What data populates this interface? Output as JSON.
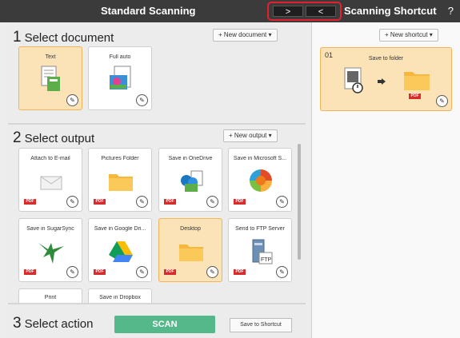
{
  "titlebar": {
    "left_title": "Standard Scanning",
    "right_title": "Scanning Shortcut",
    "help": "?",
    "nav_next": ">",
    "nav_prev": "<"
  },
  "document": {
    "number": "1",
    "heading": "Select document",
    "new_button": "+ New document ▾",
    "items": [
      {
        "label": "Text",
        "selected": true
      },
      {
        "label": "Full auto",
        "selected": false
      }
    ]
  },
  "output": {
    "number": "2",
    "heading": "Select output",
    "new_button": "+ New output ▾",
    "items": [
      {
        "label": "Attach to E-mail",
        "badge": "PDF",
        "icon": "envelope-icon"
      },
      {
        "label": "Pictures Folder",
        "badge": "PDF",
        "icon": "folder-icon"
      },
      {
        "label": "Save in OneDrive",
        "badge": "PDF",
        "icon": "onedrive-icon"
      },
      {
        "label": "Save in Microsoft S...",
        "badge": "PDF",
        "icon": "microsoft-app-icon"
      },
      {
        "label": "Save in SugarSync",
        "badge": "PDF",
        "icon": "sugarsync-hummingbird-icon"
      },
      {
        "label": "Save in Google Dri...",
        "badge": "PDF",
        "icon": "google-drive-icon"
      },
      {
        "label": "Desktop",
        "badge": "PDF",
        "icon": "folder-icon",
        "selected": true
      },
      {
        "label": "Send to FTP Server",
        "badge": "PDF",
        "icon": "ftp-server-icon"
      },
      {
        "label": "Print",
        "badge": "",
        "icon": ""
      },
      {
        "label": "Save in Dropbox",
        "badge": "",
        "icon": ""
      }
    ]
  },
  "action": {
    "number": "3",
    "heading": "Select action",
    "scan_button": "SCAN",
    "save_shortcut_button": "Save to Shortcut"
  },
  "shortcut": {
    "new_button": "+ New shortcut ▾",
    "items": [
      {
        "number": "01",
        "label": "Save to folder",
        "badge": "PDF"
      }
    ]
  },
  "colors": {
    "titlebar": "#3b3b3b",
    "selected_card": "#fbe3b7",
    "selected_border": "#f1b457",
    "scan_button": "#54b88a",
    "highlight_box": "#e4202d",
    "pdf_badge": "#d92b2b"
  }
}
